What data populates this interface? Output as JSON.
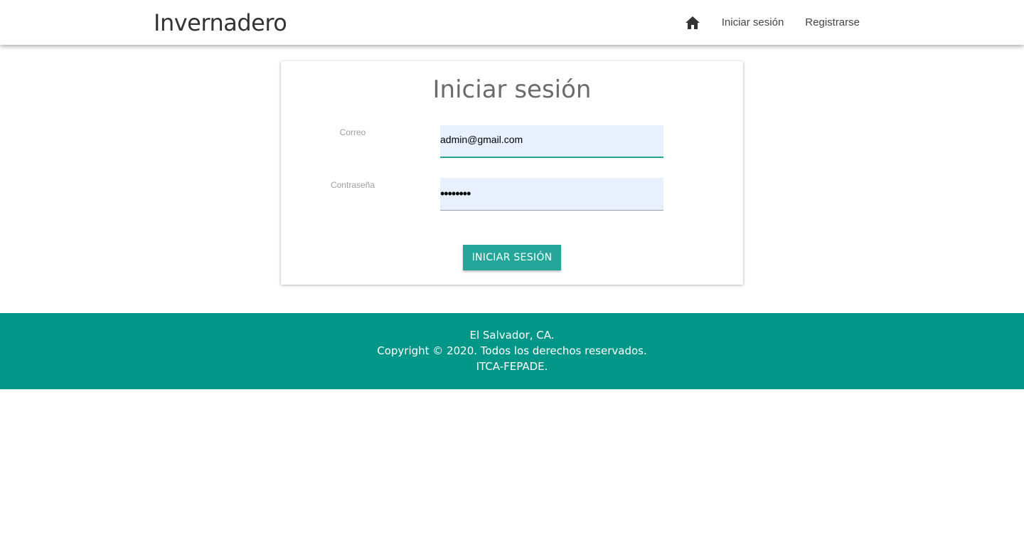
{
  "navbar": {
    "brand": "Invernadero",
    "home_icon": "home-icon",
    "links": [
      "Iniciar sesión",
      "Registrarse"
    ]
  },
  "login": {
    "title": "Iniciar sesión",
    "email_label": "Correo",
    "email_value": "admin@gmail.com",
    "password_label": "Contraseña",
    "password_value": "••••••••",
    "submit_label": "INICIAR SESIÓN"
  },
  "footer": {
    "line1": "El Salvador, CA.",
    "line2": "Copyright © 2020. Todos los derechos reservados.",
    "line3": "ITCA-FEPADE."
  },
  "colors": {
    "accent": "#26a69a",
    "footer_bg": "#009688",
    "input_bg": "#e8f0fe"
  }
}
